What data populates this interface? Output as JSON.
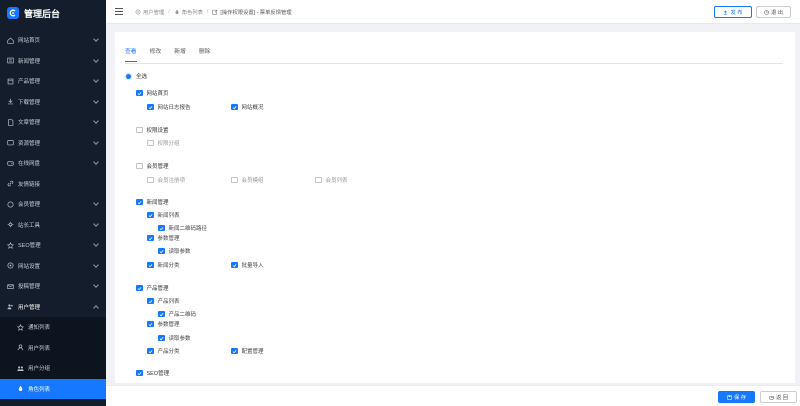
{
  "brand": {
    "title": "管理后台"
  },
  "sidebar": {
    "items": [
      {
        "label": "网站首页",
        "icon": "home-icon"
      },
      {
        "label": "新闻管理",
        "icon": "news-icon"
      },
      {
        "label": "产品管理",
        "icon": "product-icon"
      },
      {
        "label": "下载管理",
        "icon": "download-icon"
      },
      {
        "label": "文章管理",
        "icon": "article-icon"
      },
      {
        "label": "资源管理",
        "icon": "resource-icon"
      },
      {
        "label": "在线网盘",
        "icon": "disk-icon"
      },
      {
        "label": "友情链接",
        "icon": "link-icon"
      },
      {
        "label": "会员管理",
        "icon": "member-icon"
      },
      {
        "label": "站长工具",
        "icon": "tools-icon"
      },
      {
        "label": "SEO管理",
        "icon": "seo-icon"
      },
      {
        "label": "网站设置",
        "icon": "settings-icon"
      },
      {
        "label": "投稿管理",
        "icon": "mail-icon"
      },
      {
        "label": "用户管理",
        "icon": "users-icon"
      }
    ],
    "submenu": [
      {
        "label": "通知列表",
        "icon": "star-icon"
      },
      {
        "label": "用户列表",
        "icon": "user-icon"
      },
      {
        "label": "用户分组",
        "icon": "group-icon"
      },
      {
        "label": "角色列表",
        "icon": "role-icon"
      }
    ]
  },
  "header": {
    "breadcrumb": [
      "用户管理",
      "角色列表",
      "[操作权限设置] - 票单反馈管理"
    ],
    "publish_label": "发 布",
    "logout_label": "退 出"
  },
  "tabs": [
    "查看",
    "修改",
    "新增",
    "删除"
  ],
  "select_all_label": "全选",
  "permissions": {
    "home": {
      "label": "网站首页",
      "children": [
        "网站日志报告",
        "网站概况"
      ]
    },
    "perm": {
      "label": "权限设置",
      "children": [
        "权限分组"
      ]
    },
    "member": {
      "label": "会员管理",
      "children": [
        "会员注册项",
        "会员模组",
        "会员列表"
      ]
    },
    "news": {
      "label": "新闻管理",
      "list": "新闻列表",
      "qr": "新闻二维码路径",
      "params": "参数管理",
      "read_params": "读取参数",
      "category": "新闻分类",
      "import": "批量导入"
    },
    "product": {
      "label": "产品管理",
      "list": "产品列表",
      "qr": "产品二维码",
      "params": "参数管理",
      "read_params": "读取参数",
      "category": "产品分类",
      "config": "配置管理"
    },
    "seo": {
      "label": "SEO管理"
    }
  },
  "footer": {
    "save_label": "保 存",
    "back_label": "返 回"
  },
  "colors": {
    "accent": "#1677ff",
    "sidebar_bg": "#131d2c"
  }
}
